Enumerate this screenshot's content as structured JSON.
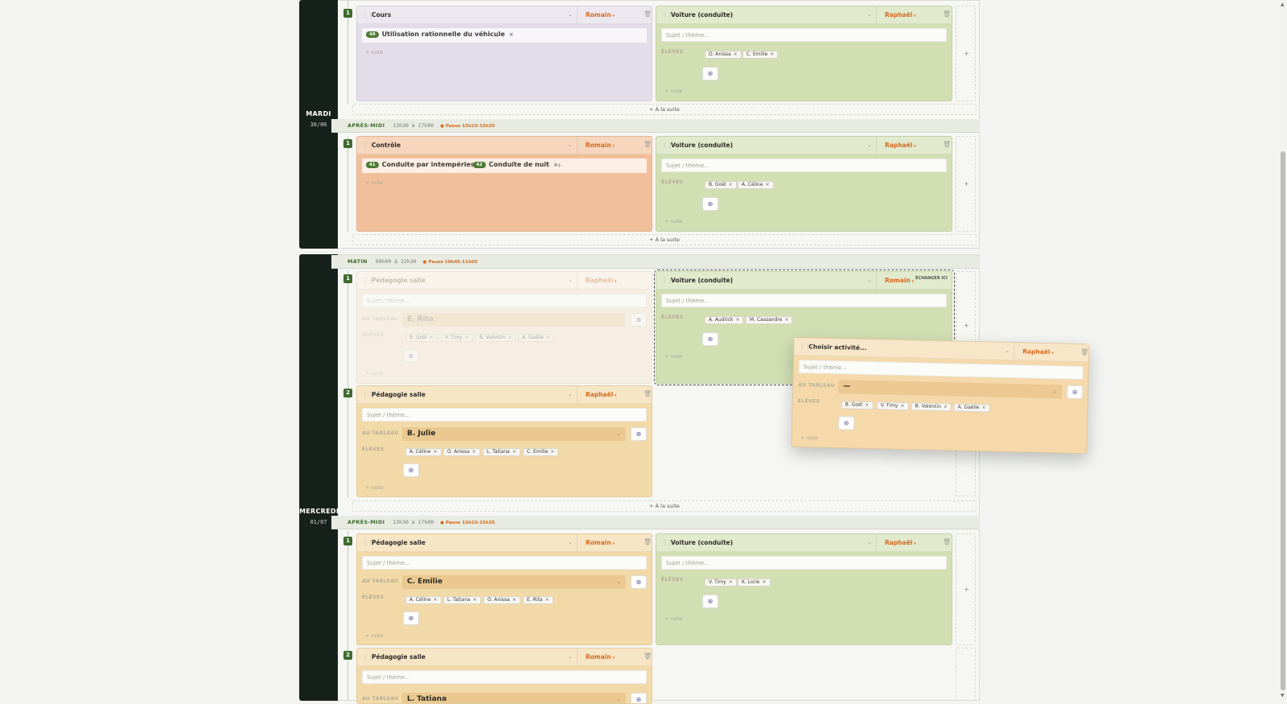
{
  "days": [
    {
      "name": "MARDI",
      "date": "30/06"
    },
    {
      "name": "MERCREDI",
      "date": "01/07"
    }
  ],
  "sections": {
    "tue_pm": {
      "tag": "APRÈS-MIDI",
      "time": "13h30 à 17h00",
      "pause": "Pause 15h15-15h35"
    },
    "wed_am": {
      "tag": "MATIN",
      "time": "09h00 à 12h30",
      "pause": "Pause 10h45-11h05"
    },
    "wed_pm": {
      "tag": "APRÈS-MIDI",
      "time": "13h30 à 17h00",
      "pause": "Pause 15h15-15h35"
    }
  },
  "labels": {
    "subject_placeholder": "Sujet / thème...",
    "note": "+ note",
    "eleves": "ÉLÈVES",
    "au_tableau": "AU TABLEAU",
    "suite": "+ À la suite",
    "swap": "ÉCHANGER ICI",
    "plus": "+"
  },
  "row_numbers": [
    "1",
    "1",
    "1",
    "2",
    "1",
    "2"
  ],
  "cards": {
    "c1": {
      "title": "Cours",
      "teacher": "Romain",
      "chips": [
        {
          "n": "48",
          "label": "Utilisation rationnelle du véhicule"
        }
      ]
    },
    "c2": {
      "title": "Voiture (conduite)",
      "teacher": "Raphaël",
      "students": [
        "O. Anissa",
        "C. Emilie"
      ]
    },
    "c3": {
      "title": "Contrôle",
      "teacher": "Romain",
      "chips": [
        {
          "n": "41",
          "label": "Conduite par intempéries"
        },
        {
          "n": "42",
          "label": "Conduite de nuit"
        }
      ]
    },
    "c4": {
      "title": "Voiture (conduite)",
      "teacher": "Raphaël",
      "students": [
        "B. Goël",
        "A. Céline"
      ]
    },
    "c5": {
      "title": "Pédagogie salle",
      "teacher": "Raphaël",
      "tableau": "E. Rita",
      "students": [
        "B. Goël",
        "V. Timy",
        "B. Valentin",
        "A. Gaëlle"
      ]
    },
    "c6": {
      "title": "Voiture (conduite)",
      "teacher": "Romain",
      "students": [
        "A. Audrick",
        "M. Cassandre"
      ]
    },
    "c7": {
      "title": "Pédagogie salle",
      "teacher": "Raphaël",
      "tableau": "B. Julie",
      "students": [
        "A. Céline",
        "O. Anissa",
        "L. Tatiana",
        "C. Emilie"
      ]
    },
    "c8": {
      "title": "Pédagogie salle",
      "teacher": "Romain",
      "tableau": "C. Emilie",
      "students": [
        "A. Céline",
        "L. Tatiana",
        "O. Anissa",
        "E. Rita"
      ]
    },
    "c9": {
      "title": "Voiture (conduite)",
      "teacher": "Raphaël",
      "students": [
        "V. Timy",
        "K. Lorie"
      ]
    },
    "c10": {
      "title": "Pédagogie salle",
      "teacher": "Romain",
      "tableau": "L. Tatiana"
    },
    "floating": {
      "title": "Choisir activité...",
      "teacher": "Raphaël",
      "tableau": "—",
      "students": [
        "B. Goël",
        "V. Timy",
        "B. Valentin",
        "A. Gaëlle"
      ]
    }
  },
  "icons": {
    "drag": "drag-handle-icon",
    "trash": "trash-icon",
    "chevron": "chevron-down-icon",
    "add_student": "add-student-icon"
  },
  "colors": {
    "accent": "#3f6b2e",
    "teacher": "#d76a1e",
    "daybar": "#17211b"
  }
}
